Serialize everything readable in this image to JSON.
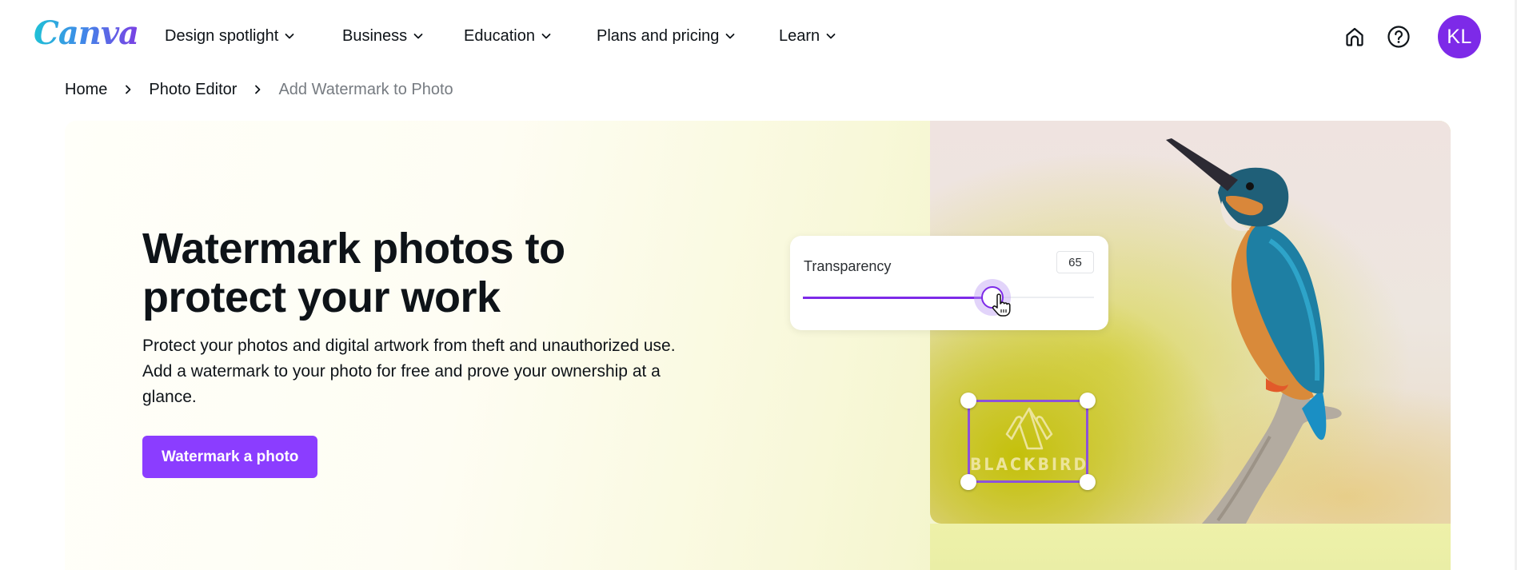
{
  "header": {
    "logo_text": "Canva",
    "nav": [
      {
        "label": "Design spotlight",
        "icon": "chevron-down-icon"
      },
      {
        "label": "Business",
        "icon": "chevron-down-icon"
      },
      {
        "label": "Education",
        "icon": "chevron-down-icon"
      },
      {
        "label": "Plans and pricing",
        "icon": "chevron-down-icon"
      },
      {
        "label": "Learn",
        "icon": "chevron-down-icon"
      }
    ],
    "home_icon": "home-icon",
    "help_icon": "help-icon",
    "avatar_initials": "KL",
    "avatar_color": "#7d2ae8"
  },
  "breadcrumb": [
    {
      "label": "Home"
    },
    {
      "label": "Photo Editor"
    },
    {
      "label": "Add Watermark to Photo",
      "current": true
    }
  ],
  "hero": {
    "title_line1": "Watermark photos to",
    "title_line2": "protect your work",
    "description": "Protect your photos and digital artwork from theft and unauthorized use. Add a watermark to your photo for free and prove your ownership at a glance.",
    "cta_label": "Watermark a photo",
    "cta_color": "#8b3dff"
  },
  "illustration": {
    "transparency_label": "Transparency",
    "transparency_value": "65",
    "slider_percent": 65,
    "watermark_text": "BLACKBIRD",
    "accent_color": "#7d2ae8"
  }
}
